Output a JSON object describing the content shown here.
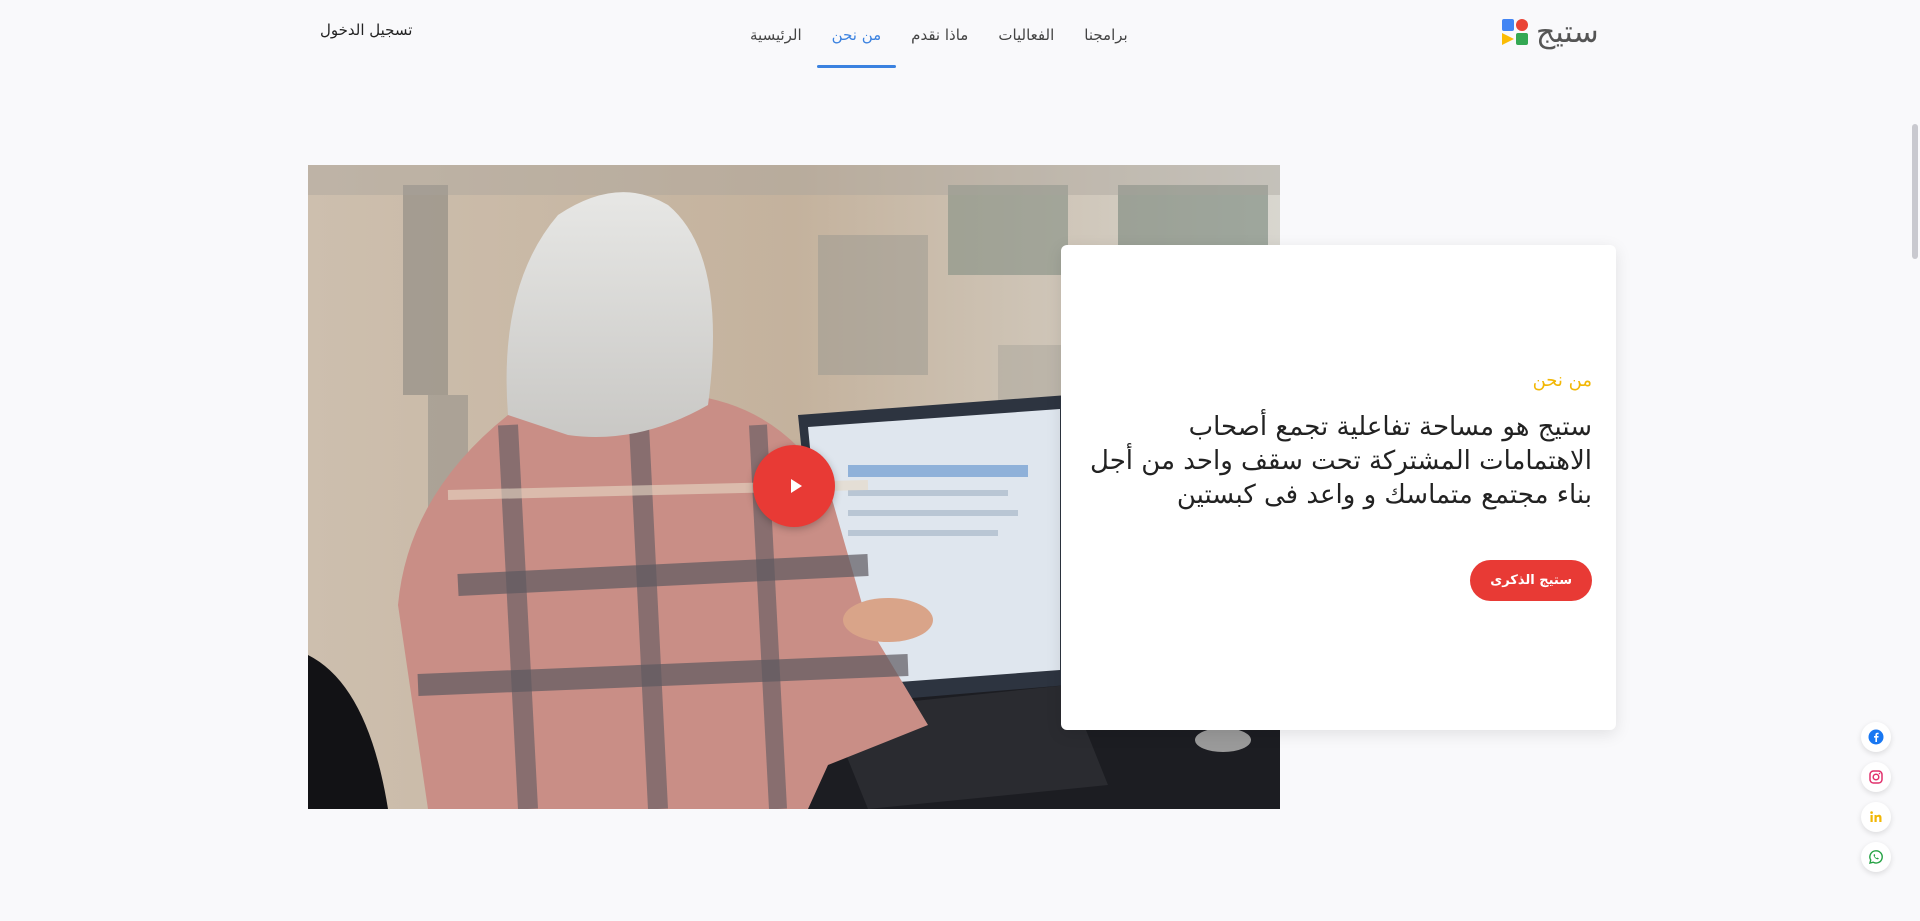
{
  "header": {
    "logo_text": "ستيج",
    "nav": [
      {
        "label": "الرئيسية",
        "active": false
      },
      {
        "label": "من نحن",
        "active": true
      },
      {
        "label": "ماذا نقدم",
        "active": false
      },
      {
        "label": "الفعاليات",
        "active": false
      },
      {
        "label": "برامجنا",
        "active": false
      }
    ],
    "login_label": "تسجيل الدخول"
  },
  "about": {
    "eyebrow": "من نحن",
    "heading": "ستيج هو مساحة تفاعلية تجمع أصحاب الاهتمامات المشتركة تحت سقف واحد من أجل بناء مجتمع متماسك و واعد فى كبستين",
    "button_label": "ستيج الذكرى"
  },
  "social": [
    "facebook-icon",
    "instagram-icon",
    "linkedin-icon",
    "whatsapp-icon"
  ],
  "colors": {
    "accent_blue": "#3b82e0",
    "accent_red": "#e83a35",
    "accent_yellow": "#f2b705",
    "background": "#f9f9fb"
  }
}
